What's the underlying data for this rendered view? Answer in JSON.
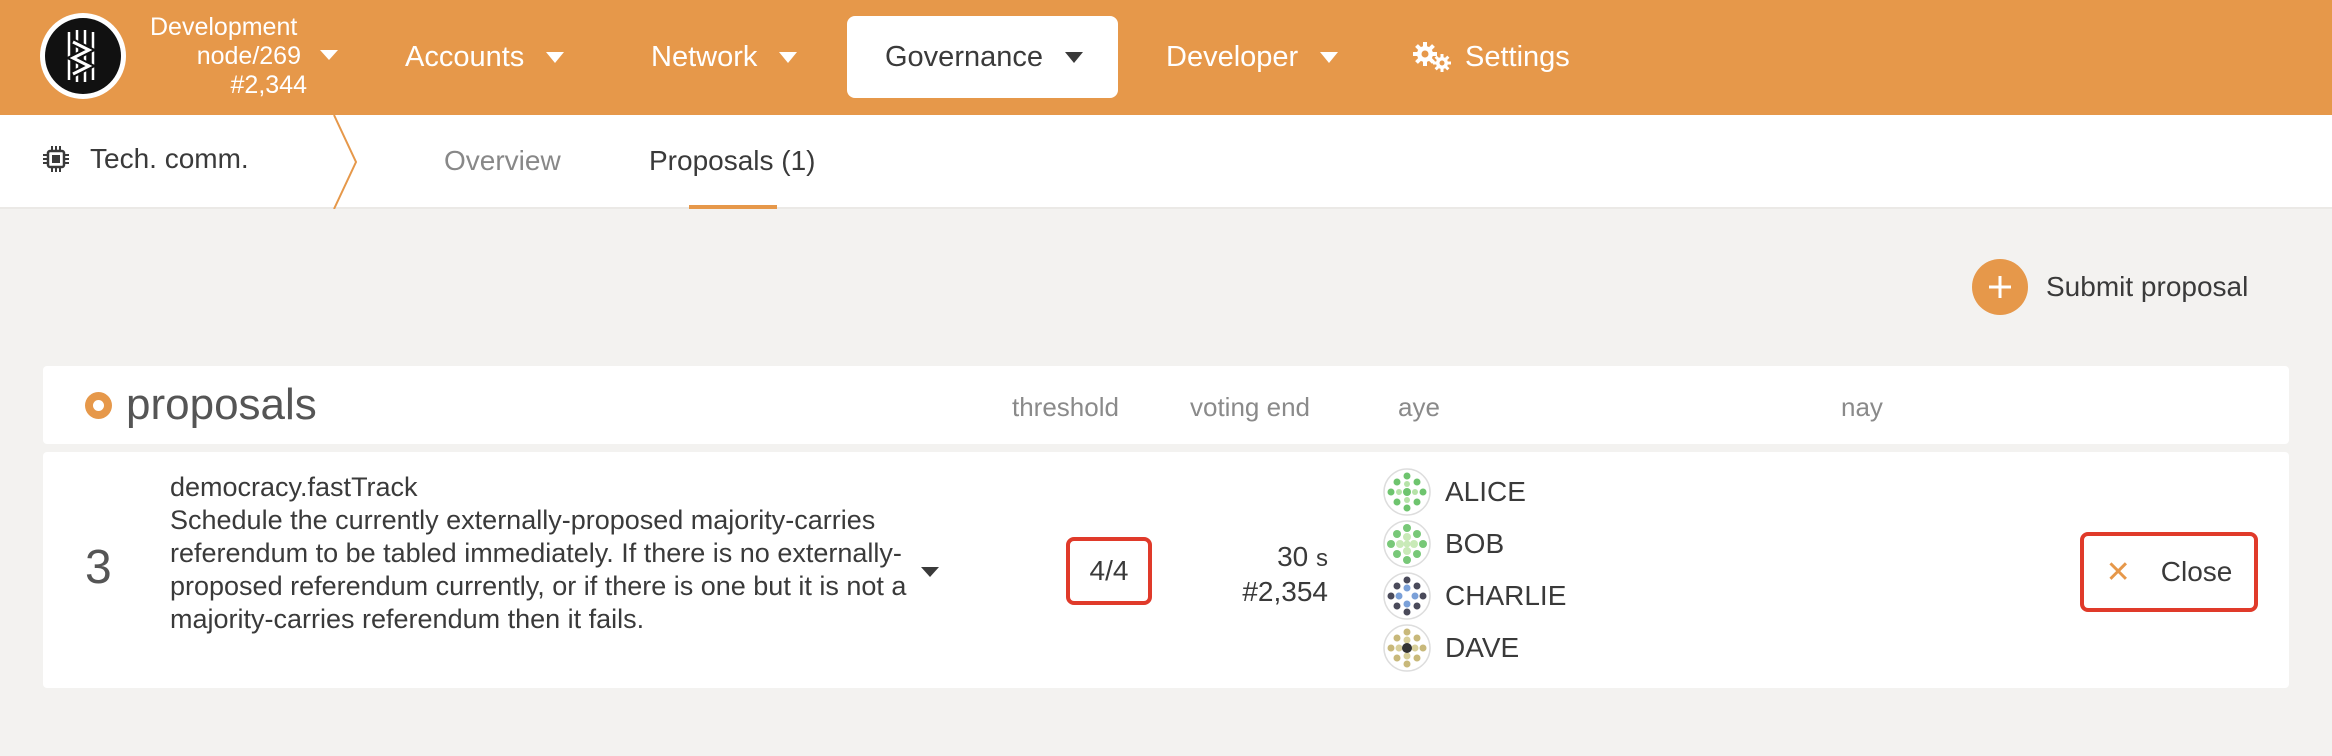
{
  "header": {
    "node": {
      "line1": "Development",
      "line2": "node/269",
      "line3": "#2,344"
    },
    "nav": [
      {
        "label": "Accounts"
      },
      {
        "label": "Network"
      },
      {
        "label": "Governance"
      },
      {
        "label": "Developer"
      },
      {
        "label": "Settings"
      }
    ]
  },
  "subnav": {
    "section": "Tech. comm.",
    "tabs": [
      {
        "label": "Overview"
      },
      {
        "label": "Proposals (1)"
      }
    ]
  },
  "actions": {
    "submit_label": "Submit proposal"
  },
  "table": {
    "title": "proposals",
    "columns": {
      "threshold": "threshold",
      "voting_end": "voting end",
      "aye": "aye",
      "nay": "nay"
    },
    "rows": [
      {
        "index": "3",
        "method": "democracy.fastTrack",
        "description": "Schedule the currently externally-proposed majority-carries referendum to be tabled immediately. If there is no externally-proposed referendum currently, or if there is one but it is not a majority-carries referendum then it fails.",
        "threshold": "4/4",
        "voting_end_time": "30",
        "voting_end_unit": "s",
        "voting_end_block": "#2,354",
        "ayes": [
          "ALICE",
          "BOB",
          "CHARLIE",
          "DAVE"
        ],
        "close_label": "Close"
      }
    ]
  },
  "colors": {
    "accent": "#e6984a",
    "highlight": "#e03a2a"
  }
}
